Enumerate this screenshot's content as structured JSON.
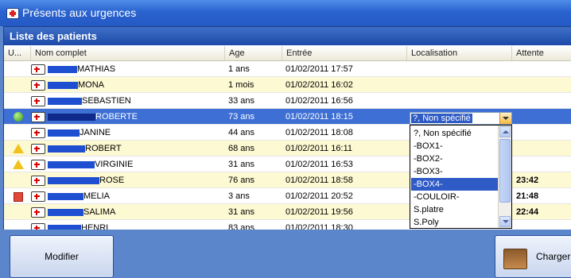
{
  "window": {
    "title": "Présents aux urgences"
  },
  "panel": {
    "title": "Liste des patients"
  },
  "columns": [
    "U...",
    "Nom complet",
    "Age",
    "Entrée",
    "Localisation",
    "Attente"
  ],
  "patients": [
    {
      "name": "MATHIAS",
      "age": "1 ans",
      "entry": "01/02/2011 17:57",
      "location": "",
      "wait": "",
      "highlight": "none",
      "indicator": "none",
      "barWidth": 37
    },
    {
      "name": "MONA",
      "age": "1 mois",
      "entry": "01/02/2011 16:02",
      "location": "",
      "wait": "",
      "highlight": "yellow",
      "indicator": "none",
      "barWidth": 38
    },
    {
      "name": "SEBASTIEN",
      "age": "33 ans",
      "entry": "01/02/2011 16:56",
      "location": "",
      "wait": "",
      "highlight": "none",
      "indicator": "none",
      "barWidth": 43
    },
    {
      "name": "ROBERTE",
      "age": "73 ans",
      "entry": "01/02/2011 18:15",
      "location": "",
      "wait": "",
      "highlight": "selected",
      "indicator": "green",
      "barWidth": 60
    },
    {
      "name": "JANINE",
      "age": "44 ans",
      "entry": "01/02/2011 18:08",
      "location": "",
      "wait": "",
      "highlight": "none",
      "indicator": "none",
      "barWidth": 40
    },
    {
      "name": "ROBERT",
      "age": "68 ans",
      "entry": "01/02/2011 16:11",
      "location": "",
      "wait": "",
      "highlight": "yellow",
      "indicator": "warning",
      "barWidth": 47
    },
    {
      "name": "VIRGINIE",
      "age": "31 ans",
      "entry": "01/02/2011 16:53",
      "location": "",
      "wait": "",
      "highlight": "none",
      "indicator": "warning",
      "barWidth": 59
    },
    {
      "name": "ROSE",
      "age": "76 ans",
      "entry": "01/02/2011 18:58",
      "location": "",
      "wait": "23:42",
      "highlight": "yellow",
      "indicator": "none",
      "barWidth": 65
    },
    {
      "name": "MELIA",
      "age": "3 ans",
      "entry": "01/02/2011 20:52",
      "location": "",
      "wait": "21:48",
      "highlight": "none",
      "indicator": "red",
      "barWidth": 45
    },
    {
      "name": "SALIMA",
      "age": "31 ans",
      "entry": "01/02/2011 19:56",
      "location": "",
      "wait": "22:44",
      "highlight": "yellow",
      "indicator": "none",
      "barWidth": 45
    },
    {
      "name": "HENRI",
      "age": "83 ans",
      "entry": "01/02/2011 18:30",
      "location": "",
      "wait": "",
      "highlight": "none",
      "indicator": "none",
      "barWidth": 42
    }
  ],
  "location_dropdown": {
    "selected_value": "?, Non spécifié",
    "options": [
      "?, Non spécifié",
      "-BOX1-",
      "-BOX2-",
      "-BOX3-",
      "-BOX4-",
      "-COULOIR-",
      "S.platre",
      "S.Poly"
    ],
    "highlighted_index": 4
  },
  "buttons": {
    "modify": "Modifier",
    "load": "Charger"
  },
  "colors": {
    "title_bar": "#2a63cf",
    "row_highlight": "#fdf9d2",
    "selection": "#3d6fd4",
    "name_bar": "#1f4fd1"
  }
}
